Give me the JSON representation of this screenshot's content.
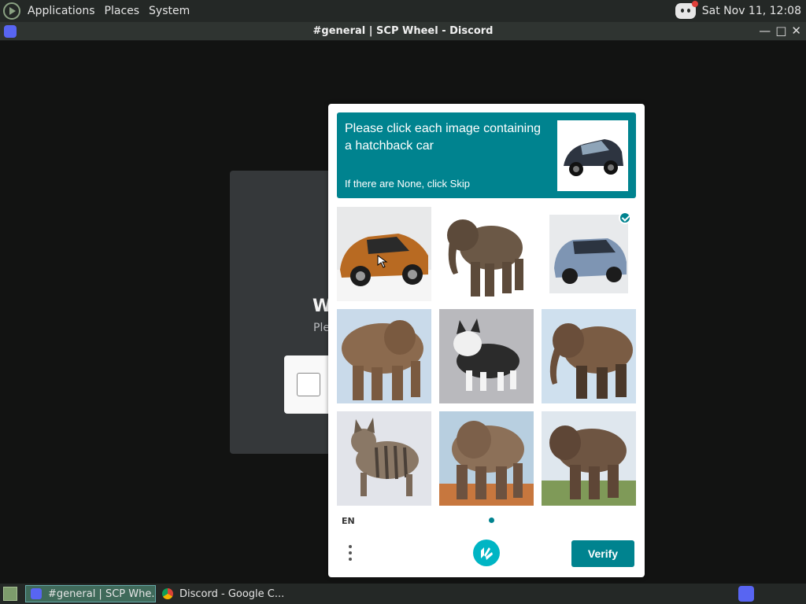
{
  "top_panel": {
    "menus": [
      "Applications",
      "Places",
      "System"
    ],
    "clock": "Sat Nov 11, 12:08"
  },
  "window": {
    "title": "#general | SCP Wheel - Discord",
    "controls": [
      "minimize-icon",
      "maximize-icon",
      "close-icon"
    ]
  },
  "background_modal": {
    "heading_fragment": "W",
    "text_fragment": "Ple"
  },
  "captcha": {
    "prompt_line": "Please click each image containing a hatchback car",
    "hint": "If there are None, click Skip",
    "tiles": [
      {
        "content": "orange hatchback car",
        "selected": false
      },
      {
        "content": "elephant",
        "selected": false
      },
      {
        "content": "blue hatchback car",
        "selected": true
      },
      {
        "content": "elephant",
        "selected": false
      },
      {
        "content": "cat",
        "selected": false
      },
      {
        "content": "elephant",
        "selected": false
      },
      {
        "content": "tabby cat",
        "selected": false
      },
      {
        "content": "elephant",
        "selected": false
      },
      {
        "content": "elephant",
        "selected": false
      }
    ],
    "language": "EN",
    "verify_label": "Verify",
    "accent": "#00838f"
  },
  "taskbar": {
    "tasks": [
      {
        "label": "#general | SCP Whe...",
        "icon": "discord-icon",
        "active": true
      },
      {
        "label": "Discord - Google C...",
        "icon": "chrome-icon",
        "active": false
      }
    ]
  }
}
